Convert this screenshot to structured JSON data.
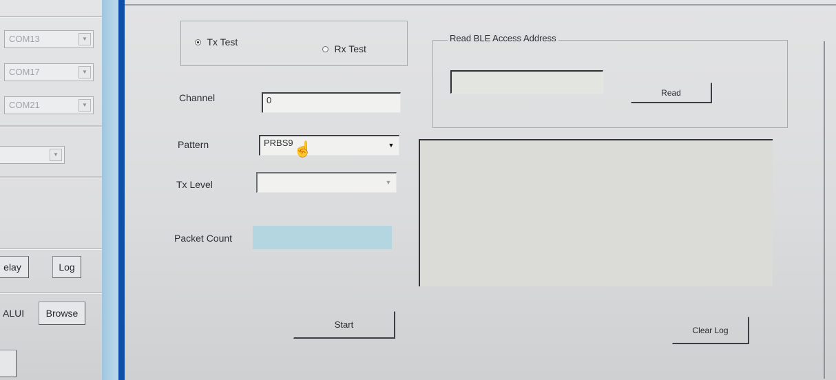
{
  "left_panel": {
    "ports": [
      "COM13",
      "COM17",
      "COM21"
    ],
    "delay_button": "elay",
    "log_button": "Log",
    "file_fragment": "ALUI",
    "browse_button": "Browse"
  },
  "test_mode": {
    "tx_label": "Tx Test",
    "rx_label": "Rx Test",
    "selected": "Tx Test"
  },
  "form": {
    "channel_label": "Channel",
    "channel_value": "0",
    "pattern_label": "Pattern",
    "pattern_value": "PRBS9",
    "tx_level_label": "Tx Level",
    "tx_level_value": "",
    "packet_count_label": "Packet Count",
    "packet_count_value": "",
    "start_button": "Start"
  },
  "ble": {
    "group_title": "Read BLE Access Address",
    "address_value": "",
    "read_button": "Read"
  },
  "log": {
    "content": "",
    "clear_button": "Clear Log"
  },
  "colors": {
    "divider_blue": "#0e4fa8",
    "packet_count_bg": "#b4d6e1"
  },
  "icons": {
    "pointer": "mouse-pointer-icon",
    "dropdown": "chevron-down-icon"
  }
}
